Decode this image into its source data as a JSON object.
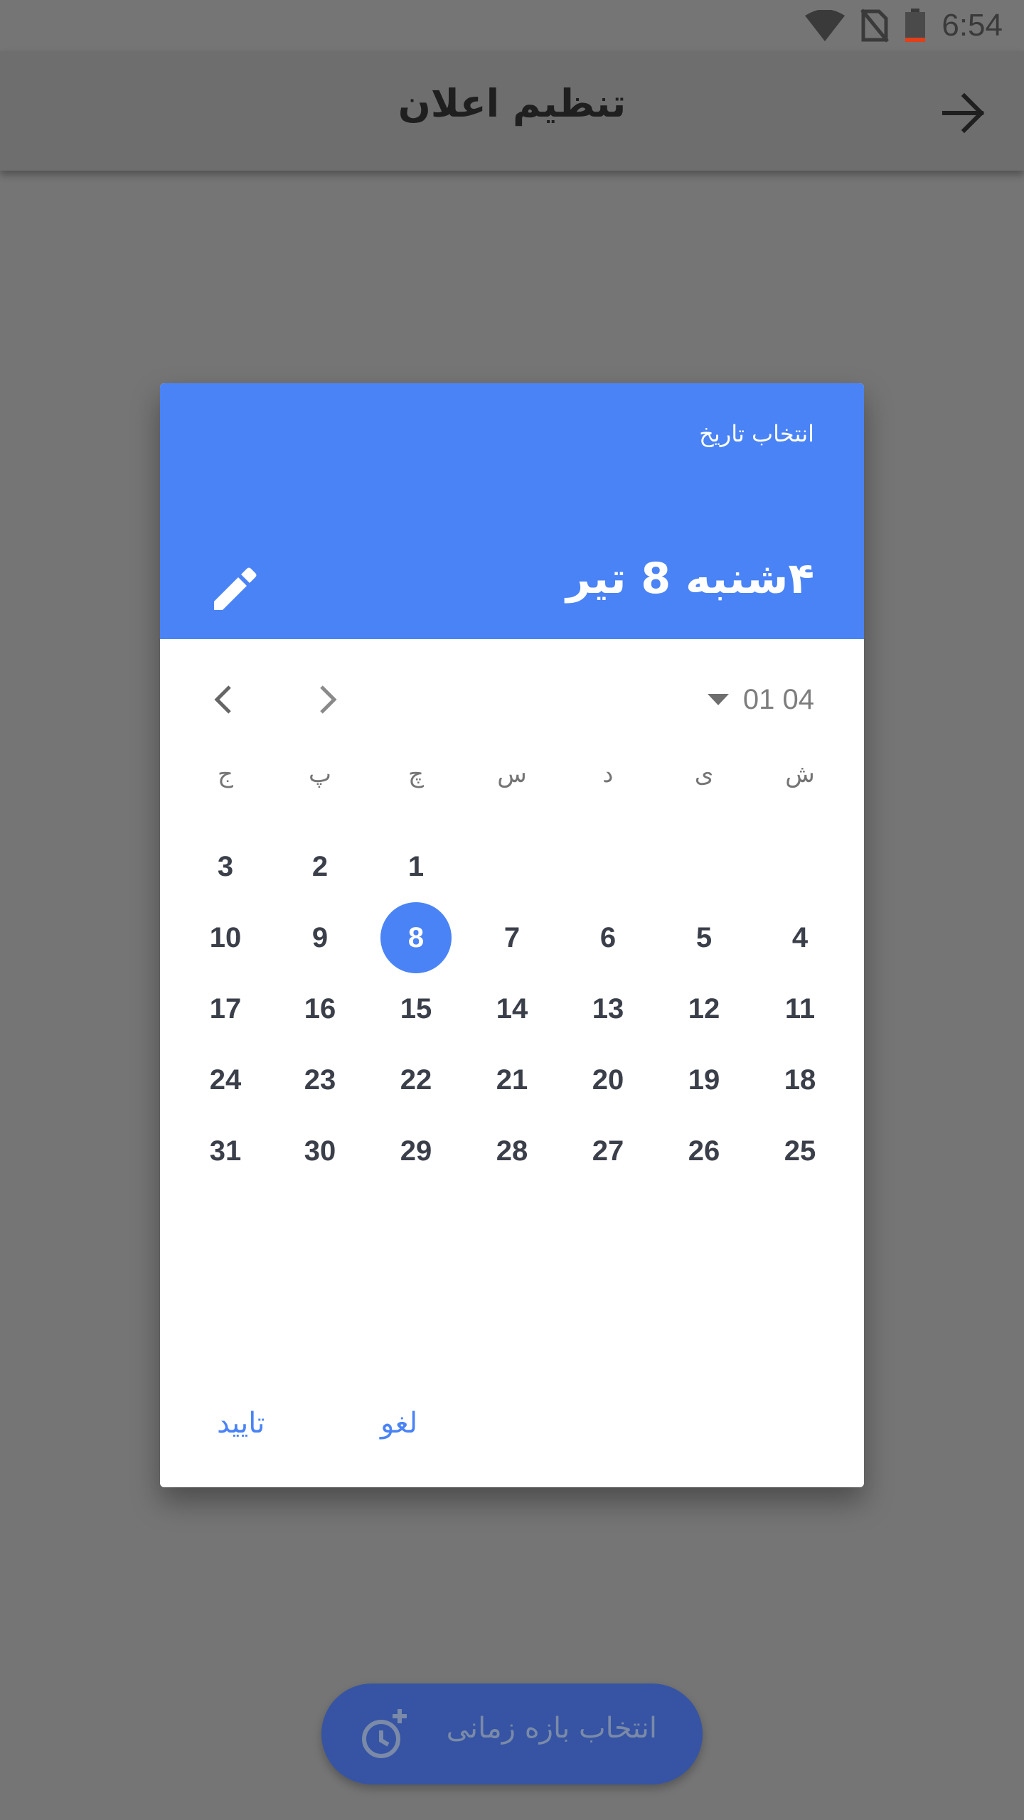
{
  "status_bar": {
    "time": "6:54",
    "icons": [
      "wifi-icon",
      "no-sim-icon",
      "battery-low-icon"
    ]
  },
  "app_bar": {
    "title": "تنظیم اعلان",
    "back_icon": "arrow-right-icon"
  },
  "dialog": {
    "label": "انتخاب تاریخ",
    "selected_date": "۴شنبه 8 تیر",
    "edit_icon": "pencil-icon",
    "month_year": "01 04",
    "weekdays": [
      "ش",
      "ی",
      "د",
      "س",
      "چ",
      "پ",
      "ج"
    ],
    "weeks": [
      [
        "",
        "",
        "",
        "",
        "1",
        "2",
        "3"
      ],
      [
        "4",
        "5",
        "6",
        "7",
        "8",
        "9",
        "10"
      ],
      [
        "11",
        "12",
        "13",
        "14",
        "15",
        "16",
        "17"
      ],
      [
        "18",
        "19",
        "20",
        "21",
        "22",
        "23",
        "24"
      ],
      [
        "25",
        "26",
        "27",
        "28",
        "29",
        "30",
        "31"
      ]
    ],
    "selected_day": "8",
    "confirm_label": "تایید",
    "cancel_label": "لغو"
  },
  "fab": {
    "label": "انتخاب بازه زمانی",
    "icon": "add-alarm-icon"
  },
  "colors": {
    "accent": "#4a83f5",
    "scrim": "#757575",
    "fab": "#3654a3"
  }
}
